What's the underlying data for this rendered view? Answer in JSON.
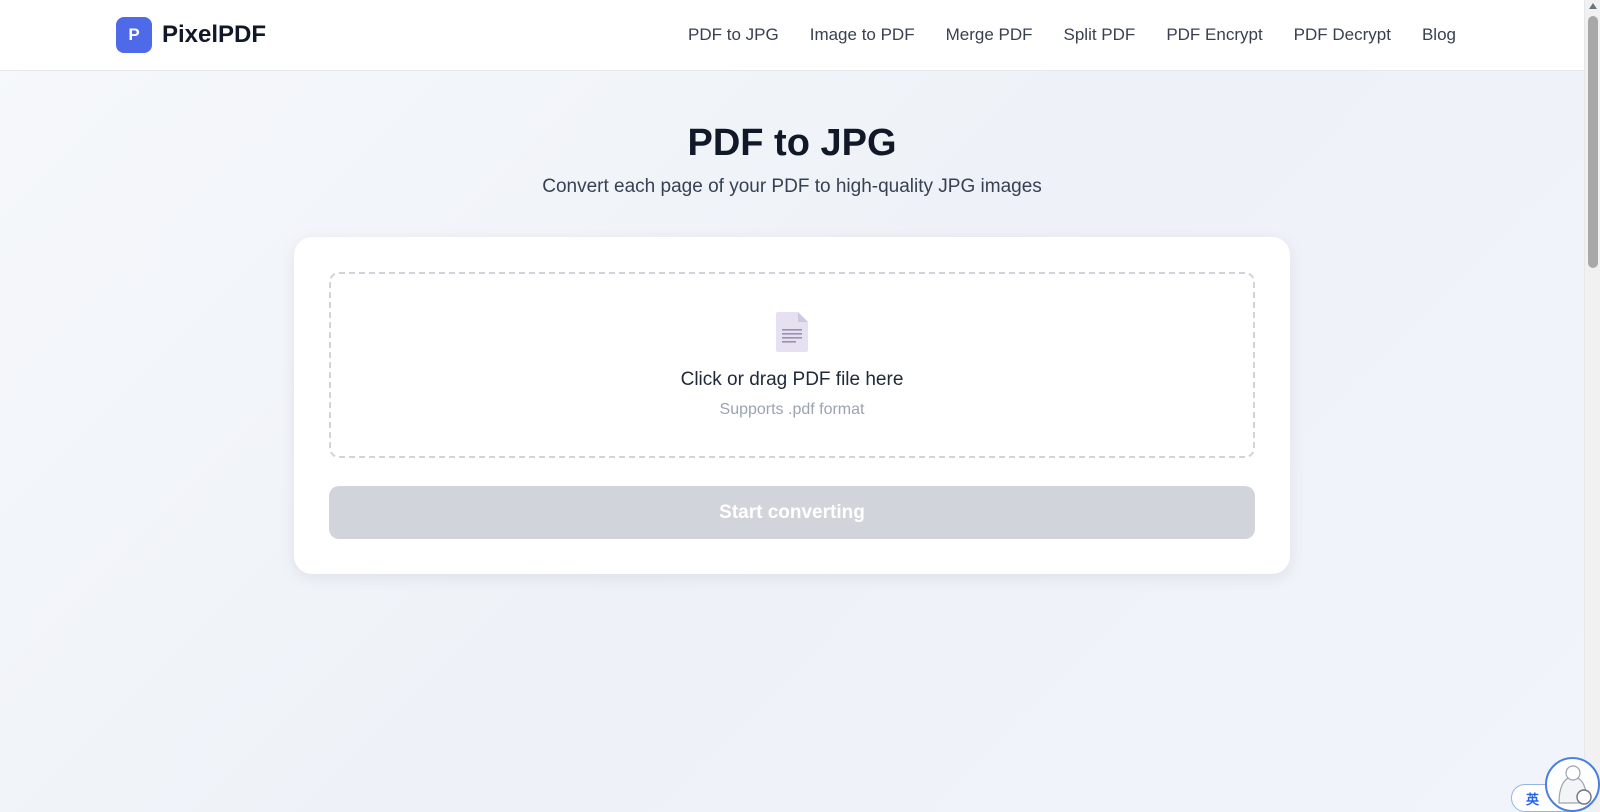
{
  "header": {
    "logo_letter": "P",
    "brand": "PixelPDF",
    "nav": [
      {
        "label": "PDF to JPG"
      },
      {
        "label": "Image to PDF"
      },
      {
        "label": "Merge PDF"
      },
      {
        "label": "Split PDF"
      },
      {
        "label": "PDF Encrypt"
      },
      {
        "label": "PDF Decrypt"
      },
      {
        "label": "Blog"
      }
    ]
  },
  "main": {
    "title": "PDF to JPG",
    "subtitle": "Convert each page of your PDF to high-quality JPG images",
    "dropzone": {
      "icon": "document-icon",
      "label": "Click or drag PDF file here",
      "hint": "Supports .pdf format"
    },
    "start_button": {
      "label": "Start converting",
      "state": "disabled"
    }
  },
  "overlay": {
    "lang_badge": "英",
    "assistant_icon": "assistant-avatar-icon"
  },
  "colors": {
    "brand": "#4f6ae8",
    "button_disabled": "#d1d5db",
    "icon_tint": "#e6e0f0"
  }
}
